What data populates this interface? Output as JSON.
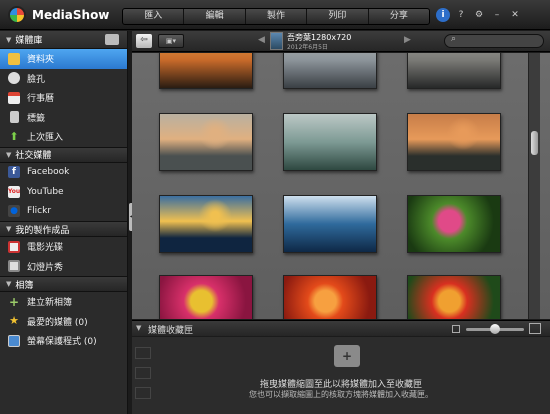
{
  "app": {
    "title": "MediaShow"
  },
  "top_nav": {
    "tabs": [
      "匯入",
      "編輯",
      "製作",
      "列印",
      "分享"
    ]
  },
  "window_controls": {
    "info": "i",
    "help": "?",
    "settings": "⚙",
    "minimize": "–",
    "close": "✕"
  },
  "sidebar": {
    "header": "媒體庫",
    "library_items": [
      {
        "label": "資料夾",
        "icon": "folder-icon",
        "selected": true
      },
      {
        "label": "臉孔",
        "icon": "face-icon"
      },
      {
        "label": "行事曆",
        "icon": "calendar-icon"
      },
      {
        "label": "標籤",
        "icon": "tag-icon"
      },
      {
        "label": "上次匯入",
        "icon": "import-icon"
      }
    ],
    "social_section": "社交媒體",
    "social_items": [
      {
        "label": "Facebook",
        "icon": "facebook-icon"
      },
      {
        "label": "YouTube",
        "icon": "youtube-icon"
      },
      {
        "label": "Flickr",
        "icon": "flickr-icon"
      }
    ],
    "productions_section": "我的製作成品",
    "productions_items": [
      {
        "label": "電影光碟",
        "icon": "movie-disc-icon"
      },
      {
        "label": "幻燈片秀",
        "icon": "slideshow-icon"
      }
    ],
    "albums_section": "相簿",
    "album_items": [
      {
        "label": "建立新相簿",
        "icon": "plus-icon"
      },
      {
        "label": "最愛的媒體 (0)",
        "icon": "star-icon"
      },
      {
        "label": "螢幕保護程式 (0)",
        "icon": "screensaver-icon"
      }
    ]
  },
  "toolbar": {
    "back": "⇦",
    "view": "▣▾",
    "prev": "◀",
    "next": "▶",
    "file_name": "吾旁葉1280x720",
    "file_date": "2012年6月5日",
    "search_placeholder": ""
  },
  "tray": {
    "title": "媒體收藏匣",
    "hint_line1": "拖曳媒體縮圖至此以將媒體加入至收藏匣",
    "hint_line2": "您也可以擷取縮圖上的核取方塊將媒體加入收藏匣。"
  },
  "thumbnails": [
    {
      "row": 0,
      "col": 0,
      "colors": [
        "#2a1c12",
        "#c86a2a",
        "#e7a34a"
      ],
      "kind": "sunset-dock"
    },
    {
      "row": 0,
      "col": 1,
      "colors": [
        "#3a3f44",
        "#8c949a",
        "#b7b9b5"
      ],
      "kind": "misty-hills"
    },
    {
      "row": 0,
      "col": 2,
      "colors": [
        "#262828",
        "#7a7a76",
        "#a8a8a2"
      ],
      "kind": "mono-hills"
    },
    {
      "row": 1,
      "col": 0,
      "colors": [
        "#4a5050",
        "#b9b0a0",
        "#e0b080"
      ],
      "kind": "sunrise-fog"
    },
    {
      "row": 1,
      "col": 1,
      "colors": [
        "#2e4840",
        "#7d9a94",
        "#bcc8c6"
      ],
      "kind": "green-fog"
    },
    {
      "row": 1,
      "col": 2,
      "colors": [
        "#2a2f2c",
        "#c77d48",
        "#e79a5a"
      ],
      "kind": "orange-sunrise"
    },
    {
      "row": 2,
      "col": 0,
      "colors": [
        "#0f2540",
        "#3a6ea0",
        "#f0c050"
      ],
      "kind": "sun-over-clouds"
    },
    {
      "row": 2,
      "col": 1,
      "colors": [
        "#0e2846",
        "#2f6a9c",
        "#cfe0ee"
      ],
      "kind": "blue-mountains"
    },
    {
      "row": 2,
      "col": 2,
      "colors": [
        "#1a3a12",
        "#4c8a2a",
        "#e04a88"
      ],
      "kind": "pink-flower"
    },
    {
      "row": 3,
      "col": 0,
      "colors": [
        "#8a1540",
        "#d8306a",
        "#e8c030"
      ],
      "kind": "tulips"
    },
    {
      "row": 3,
      "col": 1,
      "colors": [
        "#8a1a10",
        "#e34a1a",
        "#f7a040"
      ],
      "kind": "red-tulips"
    },
    {
      "row": 3,
      "col": 2,
      "colors": [
        "#1f4a1a",
        "#d83020",
        "#f0a030"
      ],
      "kind": "tulip-field"
    }
  ]
}
